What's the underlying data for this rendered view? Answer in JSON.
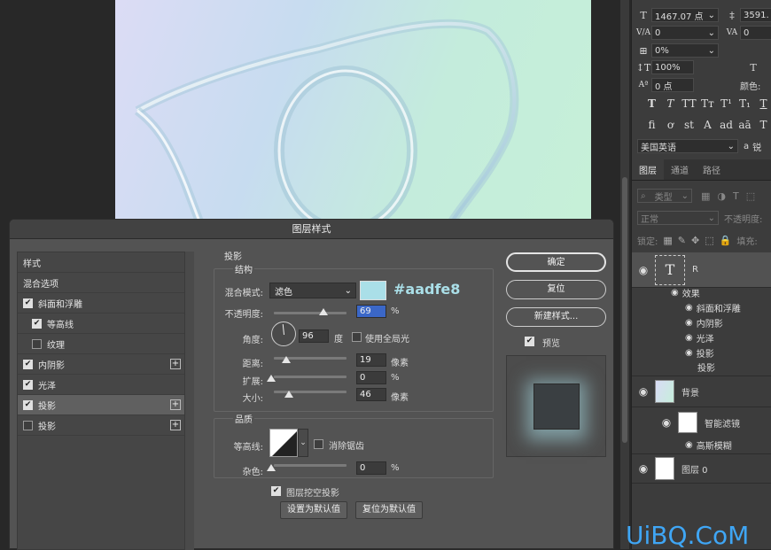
{
  "character": {
    "font_size": "1467.07 点",
    "leading": "3591.",
    "kerning": "0",
    "tracking": "0",
    "tsume": "0%",
    "vscale": "100%",
    "baseline": "0 点",
    "color_label": "颜色:",
    "language": "美国英语",
    "aa_icon": "a",
    "aa_value": "锐"
  },
  "layers_tabs": [
    "图层",
    "通道",
    "路径"
  ],
  "layers_panel": {
    "filter_kind": "类型",
    "blend_mode": "正常",
    "opacity_label": "不透明度:",
    "lock_label": "锁定:",
    "fill_label": "填充:",
    "text_layer_name": "R",
    "effects_label": "效果",
    "effects": [
      "斜面和浮雕",
      "内阴影",
      "光泽",
      "投影"
    ],
    "extra_effect": "投影",
    "bg_layer_name": "背景",
    "smart_filter_label": "智能滤镜",
    "blur_filter": "高斯模糊",
    "layer0_name": "图层 0"
  },
  "dialog": {
    "title": "图层样式",
    "styles": [
      {
        "label": "样式",
        "check": "none",
        "plus": false
      },
      {
        "label": "混合选项",
        "check": "none",
        "plus": false
      },
      {
        "label": "斜面和浮雕",
        "check": "on",
        "plus": false
      },
      {
        "label": "等高线",
        "check": "on",
        "plus": false,
        "indent": true
      },
      {
        "label": "纹理",
        "check": "off",
        "plus": false,
        "indent": true
      },
      {
        "label": "内阴影",
        "check": "on",
        "plus": true
      },
      {
        "label": "光泽",
        "check": "on",
        "plus": false
      },
      {
        "label": "投影",
        "check": "on",
        "plus": true,
        "selected": true
      },
      {
        "label": "投影",
        "check": "off",
        "plus": true
      }
    ],
    "section_title": "投影",
    "structure_title": "结构",
    "blend_mode_label": "混合模式:",
    "blend_mode_value": "滤色",
    "shadow_color": "#aadfe8",
    "color_hex_label": "#aadfe8",
    "opacity_label": "不透明度:",
    "opacity_value": "69",
    "opacity_unit": "%",
    "opacity_level": 0.69,
    "angle_label": "角度:",
    "angle_value": "96",
    "angle_unit": "度",
    "global_light_label": "使用全局光",
    "distance_label": "距离:",
    "distance_value": "19",
    "distance_unit": "像素",
    "spread_label": "扩展:",
    "spread_value": "0",
    "spread_unit": "%",
    "size_label": "大小:",
    "size_value": "46",
    "size_unit": "像素",
    "quality_title": "品质",
    "contour_label": "等高线:",
    "antialias_label": "消除锯齿",
    "noise_label": "杂色:",
    "noise_value": "0",
    "noise_unit": "%",
    "knockout_label": "图层挖空投影",
    "set_default_label": "设置为默认值",
    "reset_default_label": "复位为默认值",
    "ok_label": "确定",
    "reset_label": "复位",
    "new_style_label": "新建样式...",
    "preview_label": "预览"
  },
  "watermark": "UiBQ.CoM",
  "colors": {
    "accent": "#3b67c7",
    "shadow": "#aadfe8",
    "watermark": "#3fa6f5"
  }
}
